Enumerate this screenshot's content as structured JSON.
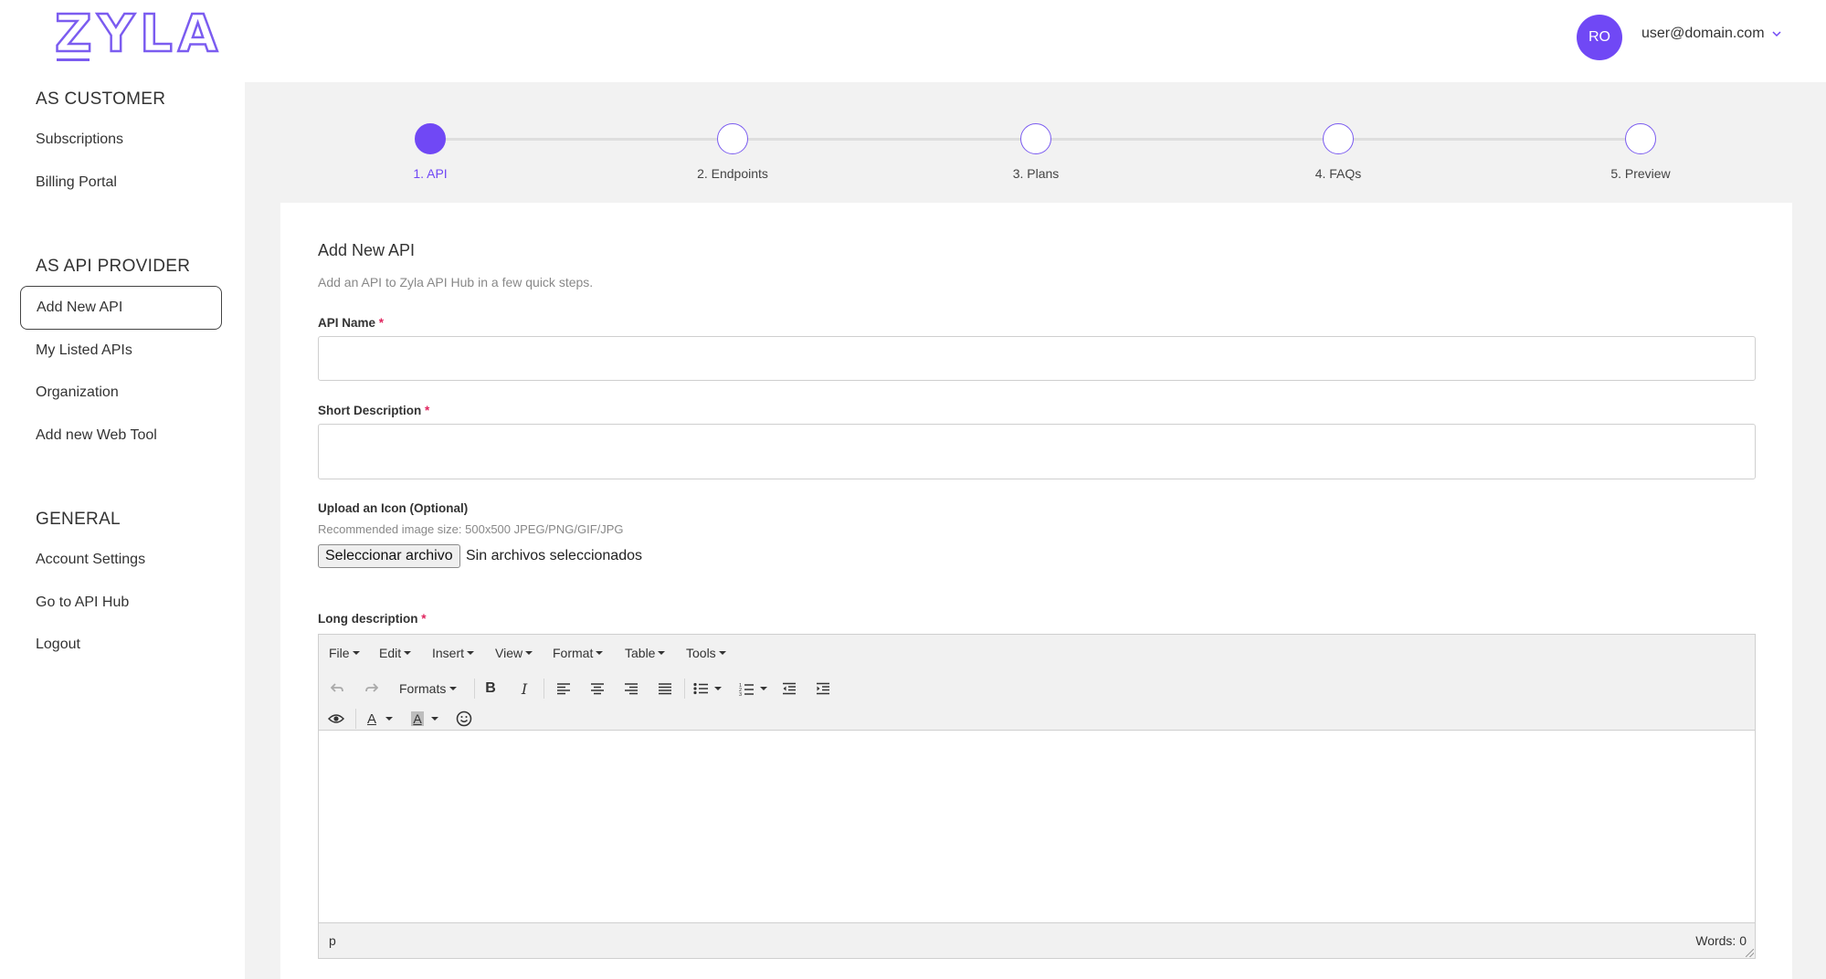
{
  "brand": {
    "logo_text": "ZYLA",
    "accent": "#7048f5"
  },
  "header": {
    "avatar_initials": "RO",
    "user_email": "user@domain.com",
    "menu_icon": "chevron-down-icon"
  },
  "sidebar": {
    "sections": [
      {
        "title": "AS CUSTOMER",
        "items": [
          {
            "label": "Subscriptions"
          },
          {
            "label": "Billing Portal"
          }
        ]
      },
      {
        "title": "AS API PROVIDER",
        "items": [
          {
            "label": "Add New API",
            "active": true
          },
          {
            "label": "My Listed APIs"
          },
          {
            "label": "Organization"
          },
          {
            "label": "Add new Web Tool"
          }
        ]
      },
      {
        "title": "GENERAL",
        "items": [
          {
            "label": "Account Settings"
          },
          {
            "label": "Go to API Hub"
          },
          {
            "label": "Logout"
          }
        ]
      }
    ]
  },
  "stepper": {
    "current": 1,
    "steps": [
      {
        "label": "1. API"
      },
      {
        "label": "2. Endpoints"
      },
      {
        "label": "3. Plans"
      },
      {
        "label": "4. FAQs"
      },
      {
        "label": "5. Preview"
      }
    ]
  },
  "form": {
    "title": "Add New API",
    "subtitle": "Add an API to Zyla API Hub in a few quick steps.",
    "required_mark": "*",
    "api_name": {
      "label": "API Name",
      "value": "",
      "placeholder": ""
    },
    "short_description": {
      "label": "Short Description",
      "value": "",
      "placeholder": ""
    },
    "icon_upload": {
      "label": "Upload an Icon (Optional)",
      "hint": "Recommended image size: 500x500 JPEG/PNG/GIF/JPG",
      "button_label": "Seleccionar archivo",
      "status": "Sin archivos seleccionados"
    },
    "long_description": {
      "label": "Long description"
    }
  },
  "editor": {
    "menus": [
      "File",
      "Edit",
      "Insert",
      "View",
      "Format",
      "Table",
      "Tools"
    ],
    "formats_label": "Formats",
    "toolbar_icons": [
      "undo-icon",
      "redo-icon",
      "bold-icon",
      "italic-icon",
      "align-left-icon",
      "align-center-icon",
      "align-right-icon",
      "align-justify-icon",
      "bullet-list-icon",
      "numbered-list-icon",
      "outdent-icon",
      "indent-icon",
      "preview-icon",
      "text-color-icon",
      "background-color-icon",
      "emoticons-icon"
    ],
    "bold_glyph": "B",
    "italic_glyph": "I",
    "text_color_glyph": "A",
    "bg_color_glyph": "A",
    "status_path": "p",
    "word_count": "Words: 0"
  }
}
